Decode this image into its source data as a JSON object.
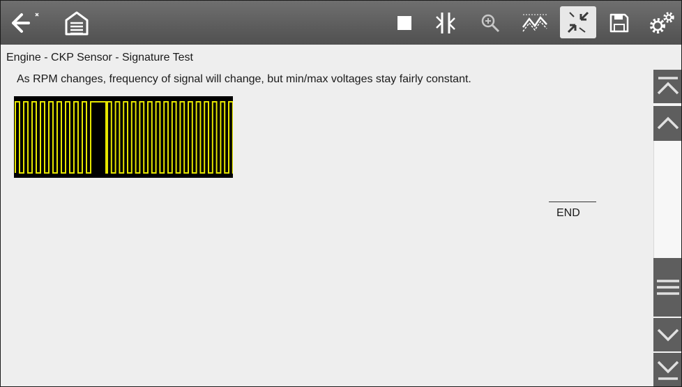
{
  "toolbar": {
    "icons": [
      "back-icon",
      "home-icon",
      "stop-icon",
      "split-screen-icon",
      "zoom-icon",
      "graph-style-icon",
      "compress-icon",
      "save-icon",
      "settings-icon"
    ],
    "active_color": "#e8e8e8",
    "background_color": "#5b5b5b"
  },
  "main": {
    "title": "Engine - CKP Sensor - Signature Test",
    "description": "As RPM changes, frequency of signal will change, but min/max voltages stay fairly constant.",
    "waveform_color": "#e6e600",
    "end_label": "END"
  },
  "scrollbar": {
    "icons": [
      "scroll-top-icon",
      "scroll-up-icon",
      "scroll-menu-icon",
      "scroll-down-icon",
      "scroll-bottom-icon"
    ]
  }
}
